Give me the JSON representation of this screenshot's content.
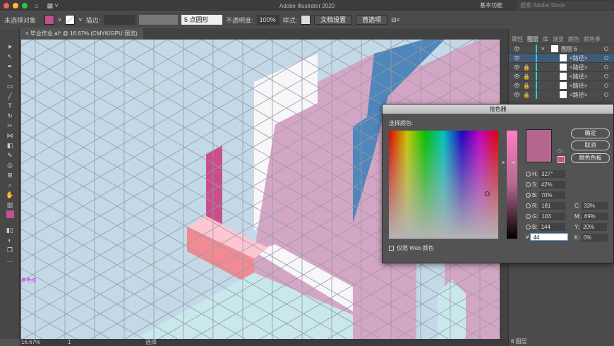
{
  "app": {
    "title": "Adobe Illustrator 2020",
    "workspace": "基本功能",
    "stock_placeholder": "搜索 Adobe Stock"
  },
  "control": {
    "selection": "未选择对象",
    "fill_color": "#c2508f",
    "stroke_label": "描边:",
    "brush": "5 点圆形",
    "opacity_label": "不透明度:",
    "opacity": "100%",
    "style_label": "样式:",
    "doc_setup": "文档设置",
    "prefs": "首选项"
  },
  "document": {
    "tab": "毕业作业.ai* @ 16.67% (CMYK/GPU 预览)",
    "guide_label": "参考线"
  },
  "status": {
    "zoom": "16.67%",
    "artboard": "1",
    "tool": "选择"
  },
  "panel": {
    "tabs": [
      "属性",
      "图层",
      "库",
      "渐变",
      "颜色",
      "颜色参"
    ],
    "active_tab": "图层",
    "layers": [
      {
        "name": "图层 6",
        "lock": false,
        "selected": false,
        "top": true
      },
      {
        "name": "<路径>",
        "lock": false,
        "selected": true
      },
      {
        "name": "<路径>",
        "lock": true
      },
      {
        "name": "<路径>",
        "lock": true
      },
      {
        "name": "<路径>",
        "lock": true
      },
      {
        "name": "<路径>",
        "lock": true
      }
    ],
    "footer": "6 图层"
  },
  "picker": {
    "title": "拾色器",
    "select_label": "选择颜色:",
    "ok": "确定",
    "cancel": "取消",
    "swatches": "颜色色板",
    "web_only": "仅限 Web 颜色",
    "H": "327°",
    "S": "42%",
    "B": "70%",
    "R": "181",
    "G": "103",
    "Bv": "144",
    "hex": "44",
    "C": "33%",
    "M": "69%",
    "Y": "20%",
    "K": "0%",
    "color": "#b56790"
  }
}
